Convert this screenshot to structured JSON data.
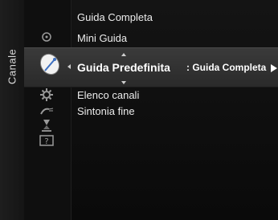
{
  "side_tab": {
    "label": "Canale"
  },
  "menu": {
    "items": [
      {
        "label": "Guida Completa"
      },
      {
        "label": "Mini Guida"
      },
      {
        "label": "Guida Predefinita",
        "value": ": Guida Completa",
        "selected": true
      },
      {
        "label": "Elenco canali"
      },
      {
        "label": "Sintonia fine"
      }
    ]
  },
  "icons": [
    "circle-icon",
    "satellite-dish-icon",
    "gear-icon",
    "antenna-icon",
    "hourglass-icon",
    "help-icon"
  ],
  "colors": {
    "background": "#0d0d0d",
    "selection": "#333333",
    "text": "#ececec"
  }
}
